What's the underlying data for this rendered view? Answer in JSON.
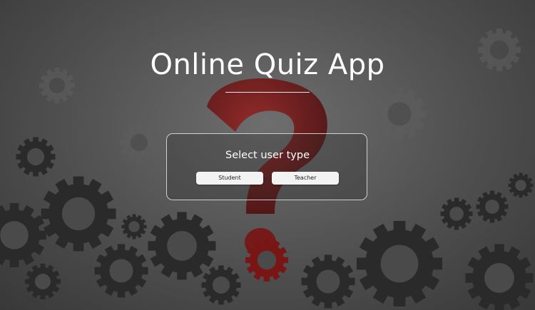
{
  "app": {
    "title": "Online Quiz App"
  },
  "user_type_panel": {
    "heading": "Select user type",
    "options": [
      {
        "label": "Student"
      },
      {
        "label": "Teacher"
      }
    ]
  },
  "background": {
    "motif": "gears-and-question-mark",
    "accent_color": "#8a1a1a",
    "base_color": "#555555"
  }
}
